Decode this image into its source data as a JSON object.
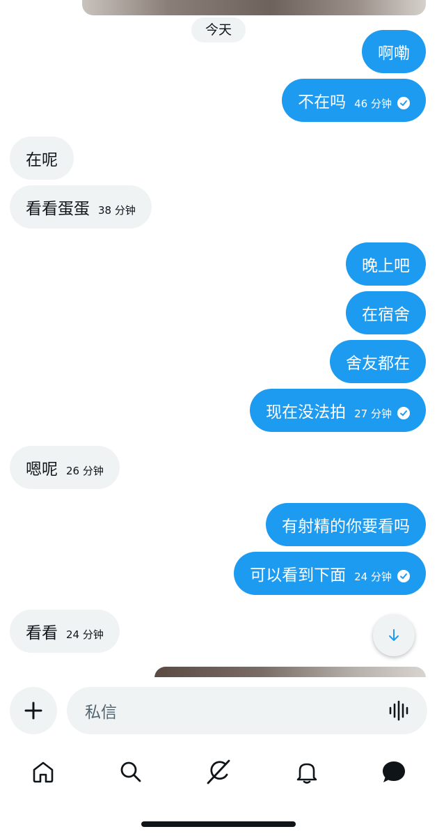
{
  "date_separator": "今天",
  "messages": [
    {
      "dir": "out",
      "text": "啊嘞"
    },
    {
      "dir": "out",
      "text": "不在吗",
      "time": "46 分钟",
      "read": true
    },
    {
      "dir": "in",
      "text": "在呢"
    },
    {
      "dir": "in",
      "text": "看看蛋蛋",
      "time": "38 分钟"
    },
    {
      "dir": "out",
      "text": "晚上吧"
    },
    {
      "dir": "out",
      "text": "在宿舍"
    },
    {
      "dir": "out",
      "text": "舍友都在"
    },
    {
      "dir": "out",
      "text": "现在没法拍",
      "time": "27 分钟",
      "read": true
    },
    {
      "dir": "in",
      "text": "嗯呢",
      "time": "26 分钟"
    },
    {
      "dir": "out",
      "text": "有射精的你要看吗"
    },
    {
      "dir": "out",
      "text": "可以看到下面",
      "time": "24 分钟",
      "read": true
    },
    {
      "dir": "in",
      "text": "看看",
      "time": "24 分钟"
    }
  ],
  "composer": {
    "placeholder": "私信"
  },
  "icons": {
    "scroll": "arrow-down-icon",
    "add": "plus-icon",
    "voice": "waveform-icon",
    "home": "home-icon",
    "search": "search-icon",
    "grok": "grok-icon",
    "notifications": "bell-icon",
    "messages": "message-icon"
  },
  "colors": {
    "accent": "#1d9bf0",
    "incoming_bg": "#eff3f4",
    "text": "#0f1419",
    "placeholder": "#536471"
  }
}
